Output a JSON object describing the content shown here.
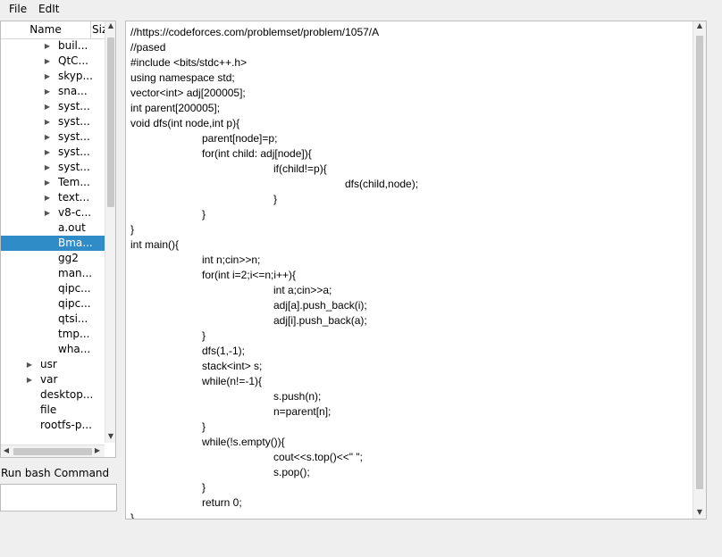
{
  "menu": [
    "File",
    "EdIt"
  ],
  "tree": {
    "columns": [
      "Name",
      "Siz"
    ],
    "rows": [
      {
        "label": "buil...",
        "arrow": true,
        "indent": 2
      },
      {
        "label": "QtC...",
        "arrow": true,
        "indent": 2
      },
      {
        "label": "skyp...",
        "arrow": true,
        "indent": 2
      },
      {
        "label": "sna...",
        "arrow": true,
        "indent": 2
      },
      {
        "label": "syst...",
        "arrow": true,
        "indent": 2
      },
      {
        "label": "syst...",
        "arrow": true,
        "indent": 2
      },
      {
        "label": "syst...",
        "arrow": true,
        "indent": 2
      },
      {
        "label": "syst...",
        "arrow": true,
        "indent": 2
      },
      {
        "label": "syst...",
        "arrow": true,
        "indent": 2
      },
      {
        "label": "Tem...",
        "arrow": true,
        "indent": 2
      },
      {
        "label": "text...",
        "arrow": true,
        "indent": 2
      },
      {
        "label": "v8-c...",
        "arrow": true,
        "indent": 2
      },
      {
        "label": "a.out",
        "arrow": false,
        "indent": 2
      },
      {
        "label": "Bma...",
        "arrow": false,
        "indent": 2,
        "selected": true
      },
      {
        "label": "gg2",
        "arrow": false,
        "indent": 2
      },
      {
        "label": "man...",
        "arrow": false,
        "indent": 2
      },
      {
        "label": "qipc...",
        "arrow": false,
        "indent": 2
      },
      {
        "label": "qipc...",
        "arrow": false,
        "indent": 2
      },
      {
        "label": "qtsi...",
        "arrow": false,
        "indent": 2
      },
      {
        "label": "tmp...",
        "arrow": false,
        "indent": 2
      },
      {
        "label": "wha...",
        "arrow": false,
        "indent": 2
      },
      {
        "label": "usr",
        "arrow": true,
        "indent": 1
      },
      {
        "label": "var",
        "arrow": true,
        "indent": 1
      },
      {
        "label": "desktop...",
        "arrow": false,
        "indent": 1
      },
      {
        "label": "file",
        "arrow": false,
        "indent": 1
      },
      {
        "label": "rootfs-p...",
        "arrow": false,
        "indent": 1
      }
    ]
  },
  "bash": {
    "label": "Run bash Command",
    "value": ""
  },
  "editor": {
    "lines": [
      {
        "text": "//https://codeforces.com/problemset/problem/1057/A",
        "indent": 0
      },
      {
        "text": "//pased",
        "indent": 0
      },
      {
        "text": "#include <bits/stdc++.h>",
        "indent": 0
      },
      {
        "text": "using namespace std;",
        "indent": 0
      },
      {
        "text": "vector<int> adj[200005];",
        "indent": 0
      },
      {
        "text": "int parent[200005];",
        "indent": 0
      },
      {
        "text": "void dfs(int node,int p){",
        "indent": 0
      },
      {
        "text": "parent[node]=p;",
        "indent": 1
      },
      {
        "text": "for(int child: adj[node]){",
        "indent": 1
      },
      {
        "text": "if(child!=p){",
        "indent": 2
      },
      {
        "text": "dfs(child,node);",
        "indent": 3
      },
      {
        "text": "}",
        "indent": 2
      },
      {
        "text": "}",
        "indent": 1
      },
      {
        "text": "}",
        "indent": 0
      },
      {
        "text": "int main(){",
        "indent": 0
      },
      {
        "text": "int n;cin>>n;",
        "indent": 1
      },
      {
        "text": "for(int i=2;i<=n;i++){",
        "indent": 1
      },
      {
        "text": "int a;cin>>a;",
        "indent": 2
      },
      {
        "text": "adj[a].push_back(i);",
        "indent": 2
      },
      {
        "text": "adj[i].push_back(a);",
        "indent": 2
      },
      {
        "text": "}",
        "indent": 1
      },
      {
        "text": "dfs(1,-1);",
        "indent": 1
      },
      {
        "text": "stack<int> s;",
        "indent": 1
      },
      {
        "text": "while(n!=-1){",
        "indent": 1
      },
      {
        "text": "s.push(n);",
        "indent": 2
      },
      {
        "text": "n=parent[n];",
        "indent": 2
      },
      {
        "text": "}",
        "indent": 1
      },
      {
        "text": "while(!s.empty()){",
        "indent": 1
      },
      {
        "text": "cout<<s.top()<<\" \";",
        "indent": 2
      },
      {
        "text": "s.pop();",
        "indent": 2
      },
      {
        "text": "}",
        "indent": 1
      },
      {
        "text": "return 0;",
        "indent": 1
      },
      {
        "text": "}",
        "indent": 0
      }
    ]
  }
}
